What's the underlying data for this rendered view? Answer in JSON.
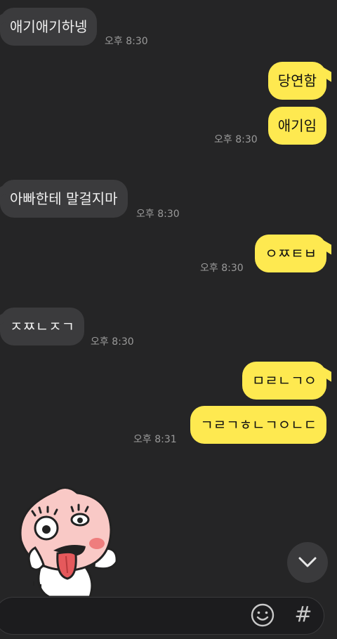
{
  "messages": [
    {
      "text": "애기애기하넹",
      "time": "오후 8:30"
    },
    {
      "text": "당연함"
    },
    {
      "text": "애기임",
      "time": "오후 8:30"
    },
    {
      "text": "아빠한테 말걸지마",
      "time": "오후 8:30"
    },
    {
      "text": "ㅇㅉㅌㅂ",
      "time": "오후 8:30"
    },
    {
      "text": "ㅈㅉㄴㅈㄱ",
      "time": "오후 8:30"
    },
    {
      "text": "ㅁㄹㄴㄱㅇ"
    },
    {
      "text": "ㄱㄹㄱㅎㄴㄱㅇㄴㄷ",
      "time": "오후 8:31"
    }
  ],
  "icons": {
    "scroll_down": "chevron-down-icon",
    "emoji": "emoji-icon",
    "hash": "hash-icon"
  },
  "hash_glyph": "#",
  "colors": {
    "background": "#252526",
    "incoming_bubble": "#3b3b3d",
    "outgoing_bubble": "#fee950",
    "timestamp": "#9a9a9a"
  }
}
